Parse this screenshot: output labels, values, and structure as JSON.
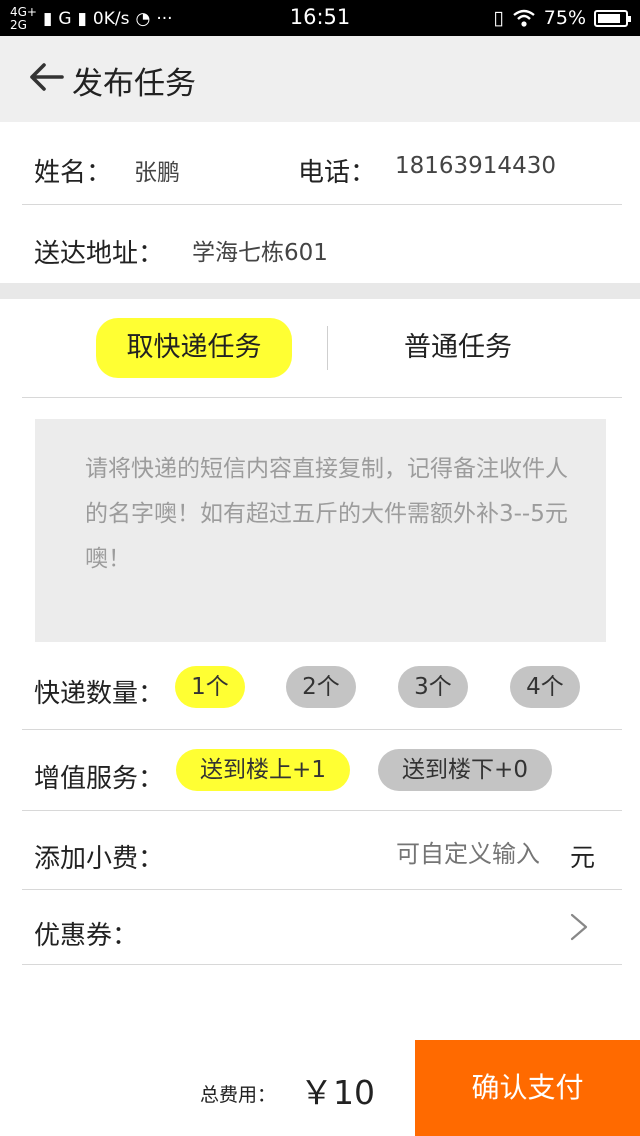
{
  "status_bar": {
    "network_top": "4G+",
    "network_bottom": "2G",
    "carrier_indicator": "G",
    "speed": "0K/s",
    "more": "···",
    "time": "16:51",
    "battery": "75%",
    "icons": [
      "signal-icon",
      "qq-icon",
      "vibrate-icon",
      "wifi-icon",
      "battery-icon"
    ]
  },
  "header": {
    "title": "发布任务",
    "back_icon": "arrow-left-icon"
  },
  "contact": {
    "name_label": "姓名：",
    "name_value": "张鹏",
    "phone_label": "电话：",
    "phone_value": "18163914430",
    "address_label": "送达地址：",
    "address_value": "学海七栋601"
  },
  "tabs": [
    {
      "label": "取快递任务",
      "active": true
    },
    {
      "label": "普通任务",
      "active": false
    }
  ],
  "note": {
    "placeholder": "请将快递的短信内容直接复制，记得备注收件人的名字噢！如有超过五斤的大件需额外补3--5元噢！"
  },
  "quantity": {
    "label": "快递数量：",
    "options": [
      "1个",
      "2个",
      "3个",
      "4个"
    ],
    "selected_index": 0
  },
  "service": {
    "label": "增值服务：",
    "options": [
      "送到楼上+1",
      "送到楼下+0"
    ],
    "selected_index": 0
  },
  "tip": {
    "label": "添加小费：",
    "placeholder": "可自定义输入",
    "unit": "元"
  },
  "coupon": {
    "label": "优惠券：",
    "chevron_icon": "chevron-right-icon"
  },
  "footer": {
    "total_label": "总费用：",
    "total_amount": "￥10",
    "pay_label": "确认支付"
  },
  "colors": {
    "accent_yellow": "#ffff33",
    "pay_orange": "#ff6a00",
    "pill_gray": "#c4c4c4",
    "header_bg": "#efefef"
  }
}
